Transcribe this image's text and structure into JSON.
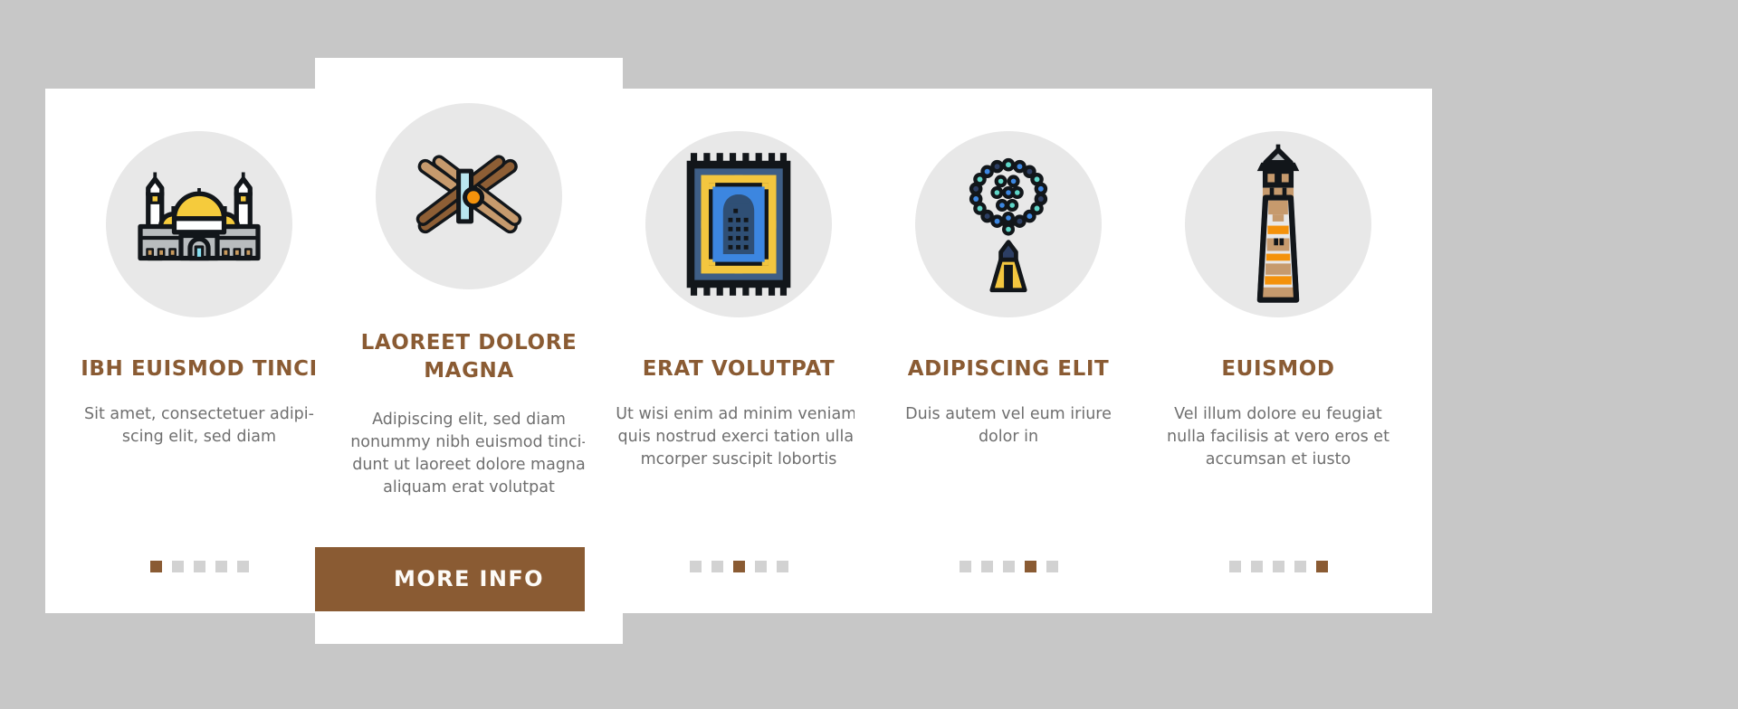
{
  "background_color": "#c7c7c7",
  "accent_color": "#8a5b33",
  "icon_bg_color": "#e8e8e8",
  "body_text_color": "#6f6f6f",
  "dot_inactive_color": "#d2d2d2",
  "cards": [
    {
      "icon_name": "mosque-icon",
      "title": "IBH EUISMOD TINCI",
      "description": "Sit amet, consectetuer adipi-\nscing elit, sed diam",
      "dots": [
        true,
        false,
        false,
        false,
        false
      ],
      "featured": false,
      "button_label": null
    },
    {
      "icon_name": "quran-stand-icon",
      "title": "LAOREET DOLORE MAGNA",
      "description": "Adipiscing elit, sed diam\nnonummy nibh euismod tinci-\ndunt ut laoreet dolore magna\naliquam erat volutpat",
      "dots": null,
      "featured": true,
      "button_label": "MORE INFO"
    },
    {
      "icon_name": "prayer-rug-icon",
      "title": "ERAT VOLUTPAT",
      "description": "Ut wisi enim ad minim veniam,\nquis nostrud exerci tation ulla-\nmcorper suscipit lobortis",
      "dots": [
        false,
        false,
        true,
        false,
        false
      ],
      "featured": false,
      "button_label": null
    },
    {
      "icon_name": "prayer-beads-icon",
      "title": "ADIPISCING ELIT",
      "description": "Duis autem vel eum iriure\ndolor in",
      "dots": [
        false,
        false,
        false,
        true,
        false
      ],
      "featured": false,
      "button_label": null
    },
    {
      "icon_name": "minaret-icon",
      "title": "EUISMOD",
      "description": "Vel illum dolore eu feugiat\nnulla facilisis at vero eros et\naccumsan et iusto",
      "dots": [
        false,
        false,
        false,
        false,
        true
      ],
      "featured": false,
      "button_label": null
    }
  ]
}
